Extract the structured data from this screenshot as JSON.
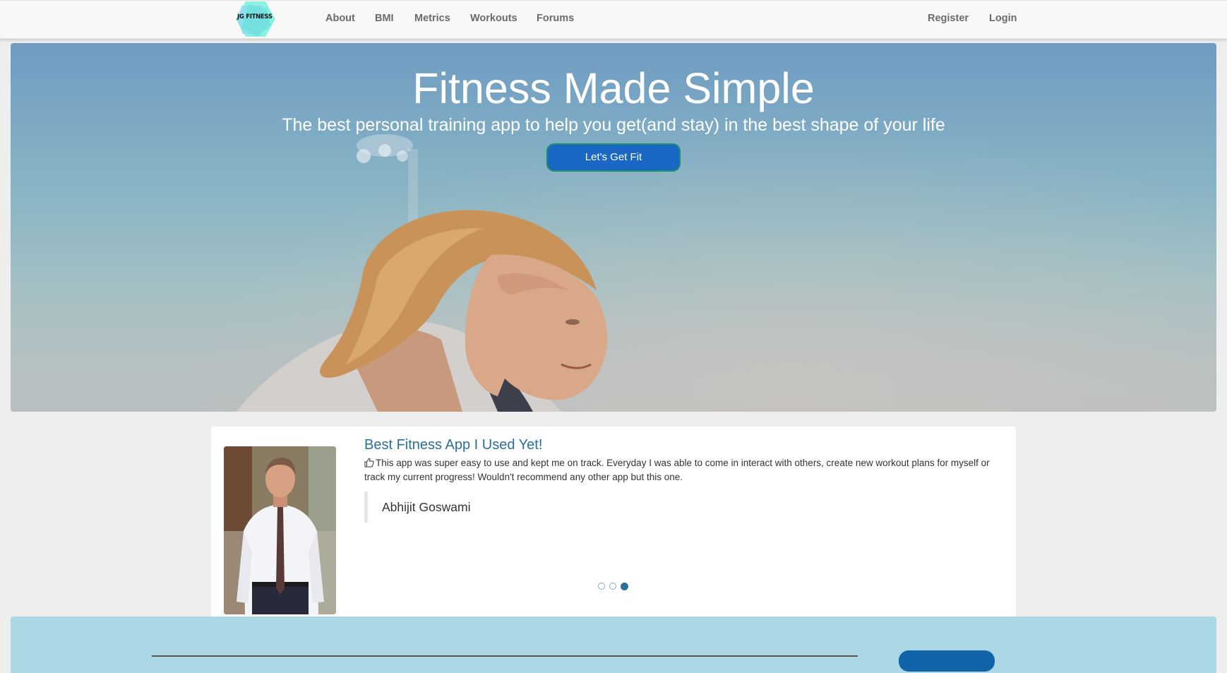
{
  "brand": {
    "logo_text": "JG FITNESS",
    "logo_colors": [
      "#5fe0d2",
      "#8fd8f5",
      "#7ff0e0"
    ]
  },
  "nav": {
    "left_links": [
      "About",
      "BMI",
      "Metrics",
      "Workouts",
      "Forums"
    ],
    "right_links": [
      "Register",
      "Login"
    ]
  },
  "hero": {
    "title": "Fitness Made Simple",
    "subtitle": "The best personal training app to help you get(and stay) in the best shape of your life",
    "cta_label": "Let's Get Fit"
  },
  "testimonial": {
    "title": "Best Fitness App I Used Yet!",
    "body": "This app was super easy to use and kept me on track. Everyday I was able to come in interact with others, create new workout plans for myself or track my current progress! Wouldn't recommend any other app but this one.",
    "author": "Abhijit Goswami",
    "slide_count": 3,
    "active_slide": 3
  },
  "colors": {
    "accent": "#1a67c6",
    "title_blue": "#2a6f9a",
    "band": "#acd8e5"
  }
}
